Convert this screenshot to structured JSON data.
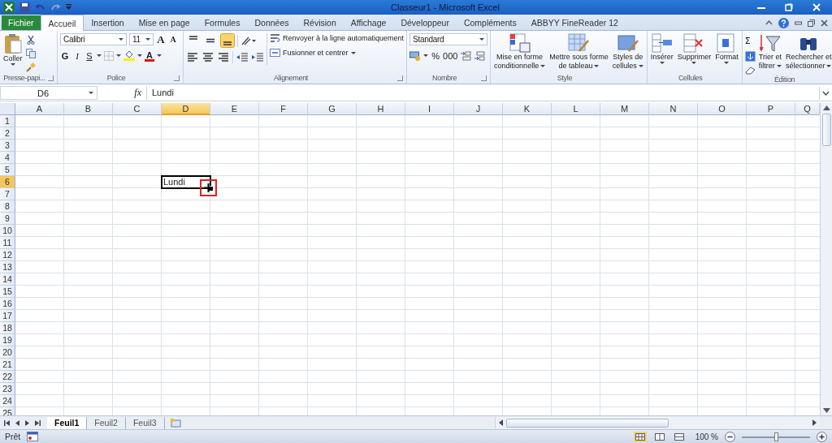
{
  "window": {
    "title": "Classeur1 - Microsoft Excel"
  },
  "tabs": [
    {
      "label": "Fichier",
      "kind": "file",
      "selected": false
    },
    {
      "label": "Accueil",
      "kind": "tab",
      "selected": true
    },
    {
      "label": "Insertion",
      "kind": "tab",
      "selected": false
    },
    {
      "label": "Mise en page",
      "kind": "tab",
      "selected": false
    },
    {
      "label": "Formules",
      "kind": "tab",
      "selected": false
    },
    {
      "label": "Données",
      "kind": "tab",
      "selected": false
    },
    {
      "label": "Révision",
      "kind": "tab",
      "selected": false
    },
    {
      "label": "Affichage",
      "kind": "tab",
      "selected": false
    },
    {
      "label": "Développeur",
      "kind": "tab",
      "selected": false
    },
    {
      "label": "Compléments",
      "kind": "tab",
      "selected": false
    },
    {
      "label": "ABBYY FineReader 12",
      "kind": "tab",
      "selected": false
    }
  ],
  "ribbon": {
    "clipboard": {
      "label": "Presse-papi...",
      "paste": "Coller"
    },
    "font": {
      "label": "Police",
      "font_name": "Calibri",
      "font_size": "11",
      "grow": "A",
      "shrink": "A",
      "bold": "G",
      "italic": "I",
      "underline": "S",
      "font_color": "A"
    },
    "alignment": {
      "label": "Alignement",
      "vertical": [
        {
          "selected": false
        },
        {
          "selected": false
        },
        {
          "selected": true
        }
      ],
      "wrap_text": "Renvoyer à la ligne automatiquement",
      "merge": "Fusionner et centrer"
    },
    "number": {
      "label": "Nombre",
      "format": "Standard",
      "percent": "%",
      "thousands": "000"
    },
    "styles": {
      "label": "Style",
      "buttons": [
        {
          "lines": [
            "Mise en forme",
            "conditionnelle"
          ]
        },
        {
          "lines": [
            "Mettre sous forme",
            "de tableau"
          ]
        },
        {
          "lines": [
            "Styles de",
            "cellules"
          ]
        }
      ]
    },
    "cells": {
      "label": "Cellules",
      "buttons": [
        "Insérer",
        "Supprimer",
        "Format"
      ]
    },
    "editing": {
      "label": "Édition",
      "sum": "Σ",
      "buttons": [
        {
          "lines": [
            "Trier et",
            "filtrer"
          ]
        },
        {
          "lines": [
            "Rechercher et",
            "sélectionner"
          ]
        }
      ]
    }
  },
  "formula_bar": {
    "name_box": "D6",
    "function_label": "fx",
    "value": "Lundi"
  },
  "sheet": {
    "columns": [
      {
        "label": "A",
        "selected": false
      },
      {
        "label": "B",
        "selected": false
      },
      {
        "label": "C",
        "selected": false
      },
      {
        "label": "D",
        "selected": true
      },
      {
        "label": "E",
        "selected": false
      },
      {
        "label": "F",
        "selected": false
      },
      {
        "label": "G",
        "selected": false
      },
      {
        "label": "H",
        "selected": false
      },
      {
        "label": "I",
        "selected": false
      },
      {
        "label": "J",
        "selected": false
      },
      {
        "label": "K",
        "selected": false
      },
      {
        "label": "L",
        "selected": false
      },
      {
        "label": "M",
        "selected": false
      },
      {
        "label": "N",
        "selected": false
      },
      {
        "label": "O",
        "selected": false
      },
      {
        "label": "P",
        "selected": false
      },
      {
        "label": "Q",
        "selected": false
      }
    ],
    "rows": [
      {
        "label": "1",
        "selected": false
      },
      {
        "label": "2",
        "selected": false
      },
      {
        "label": "3",
        "selected": false
      },
      {
        "label": "4",
        "selected": false
      },
      {
        "label": "5",
        "selected": false
      },
      {
        "label": "6",
        "selected": true
      },
      {
        "label": "7",
        "selected": false
      },
      {
        "label": "8",
        "selected": false
      },
      {
        "label": "9",
        "selected": false
      },
      {
        "label": "10",
        "selected": false
      },
      {
        "label": "11",
        "selected": false
      },
      {
        "label": "12",
        "selected": false
      },
      {
        "label": "13",
        "selected": false
      },
      {
        "label": "14",
        "selected": false
      },
      {
        "label": "15",
        "selected": false
      },
      {
        "label": "16",
        "selected": false
      },
      {
        "label": "17",
        "selected": false
      },
      {
        "label": "18",
        "selected": false
      },
      {
        "label": "19",
        "selected": false
      },
      {
        "label": "20",
        "selected": false
      },
      {
        "label": "21",
        "selected": false
      },
      {
        "label": "22",
        "selected": false
      },
      {
        "label": "23",
        "selected": false
      },
      {
        "label": "24",
        "selected": false
      },
      {
        "label": "25",
        "selected": false
      }
    ],
    "active_cell": {
      "value": "Lundi"
    }
  },
  "sheet_tabs": [
    {
      "label": "Feuil1",
      "selected": true
    },
    {
      "label": "Feuil2",
      "selected": false
    },
    {
      "label": "Feuil3",
      "selected": false
    }
  ],
  "status_bar": {
    "text": "Prêt",
    "views": [
      {
        "selected": true
      },
      {
        "selected": false
      },
      {
        "selected": false
      }
    ],
    "zoom": "100 %",
    "level": 0.5
  }
}
